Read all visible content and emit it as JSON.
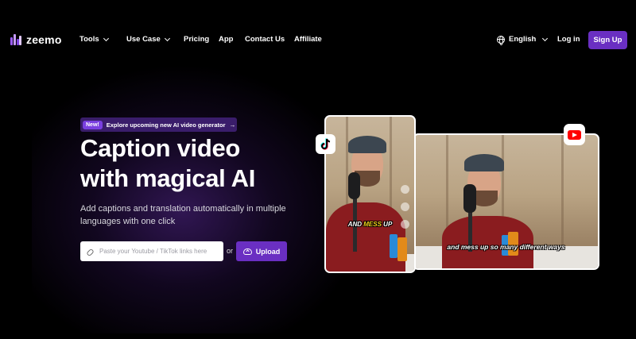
{
  "brand": {
    "name": "zeemo",
    "accent": "#6a2fc2"
  },
  "nav": {
    "items": [
      {
        "label": "Tools",
        "has_dropdown": true
      },
      {
        "label": "Use Case",
        "has_dropdown": true
      },
      {
        "label": "Pricing",
        "has_dropdown": false
      },
      {
        "label": "App",
        "has_dropdown": false
      },
      {
        "label": "Contact Us",
        "has_dropdown": false
      },
      {
        "label": "Affiliate",
        "has_dropdown": false
      }
    ],
    "language": "English",
    "login": "Log in",
    "signup": "Sign Up"
  },
  "hero": {
    "pill_tag": "New!",
    "pill_text": "Explore upcoming new AI video generator",
    "pill_arrow": "→",
    "headline_line1": "Caption video",
    "headline_line2": "with magical AI",
    "subtitle": "Add captions and translation automatically in multiple languages with one click",
    "input_placeholder": "Paste your Youtube / TikTok links here",
    "or_text": "or",
    "upload_label": "Upload"
  },
  "preview": {
    "tall_caption_part1": "AND",
    "tall_caption_part2": "MESS",
    "tall_caption_part3": "UP",
    "wide_caption": "and mess up so many different ways",
    "badges": [
      "tiktok-icon",
      "youtube-icon"
    ]
  }
}
